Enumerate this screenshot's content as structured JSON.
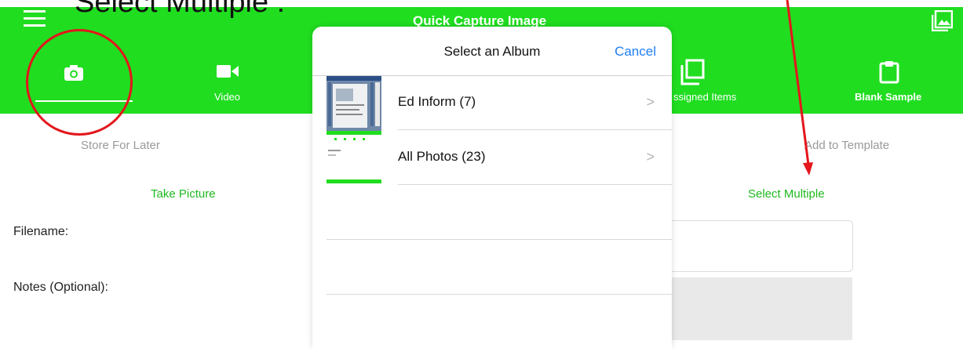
{
  "headline": "Select Multiple :",
  "header": {
    "title": "Quick Capture Image",
    "menu_icon": "hamburger-icon",
    "gallery_icon": "gallery-icon"
  },
  "tabs": [
    {
      "label": "",
      "icon": "camera-icon",
      "selected": true
    },
    {
      "label": "Video",
      "icon": "video-icon"
    },
    {
      "label": "ssigned Items",
      "icon": "assigned-items-icon"
    },
    {
      "label": "Blank Sample",
      "icon": "clipboard-icon"
    }
  ],
  "actions": {
    "store_later": "Store For Later",
    "add_template": "Add to Template",
    "take_picture": "Take Picture",
    "select_multiple": "Select Multiple"
  },
  "form": {
    "filename_label": "Filename:",
    "notes_label": "Notes (Optional):"
  },
  "modal": {
    "title": "Select an Album",
    "cancel": "Cancel",
    "albums": [
      {
        "label": "Ed Inform (7)"
      },
      {
        "label": "All Photos (23)"
      }
    ]
  },
  "colors": {
    "green": "#20dd20",
    "annotation_red": "#e3161c",
    "link_blue": "#1f7ef5"
  }
}
